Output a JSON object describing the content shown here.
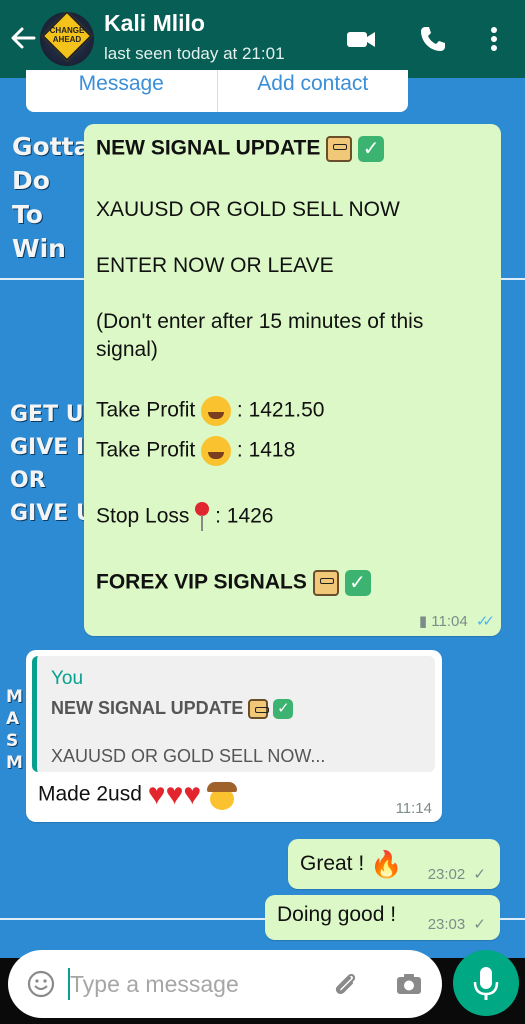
{
  "header": {
    "contact_name": "Kali Mlilo",
    "last_seen": "last seen today at 21:01",
    "avatar_text": "CHANGE AHEAD"
  },
  "action_card": {
    "message_label": "Message",
    "add_contact_label": "Add contact"
  },
  "wallpaper": {
    "line1": [
      "Gotta",
      "Do",
      "To",
      "Win"
    ],
    "line2": [
      "GET UP",
      "GIVE IT",
      "OR",
      "GIVE U"
    ],
    "line3": [
      "M",
      "A",
      "S",
      "M"
    ]
  },
  "messages": [
    {
      "direction": "outgoing",
      "lines": [
        "NEW SIGNAL UPDATE",
        "XAUUSD OR GOLD SELL NOW",
        "ENTER NOW OR LEAVE",
        "(Don't enter after 15 minutes of this",
        "signal)",
        "Take Profit",
        ": 1421.50",
        "Take Profit",
        ": 1418",
        "Stop Loss",
        ": 1426",
        "FOREX VIP SIGNALS"
      ],
      "time": "11:04",
      "status": "read"
    },
    {
      "direction": "incoming",
      "quote": {
        "author": "You",
        "title": "NEW SIGNAL UPDATE",
        "preview": "XAUUSD OR GOLD SELL NOW..."
      },
      "text": "Made 2usd",
      "time": "11:14"
    },
    {
      "direction": "outgoing",
      "text": "Great !",
      "time": "23:02",
      "status": "sent"
    },
    {
      "direction": "outgoing",
      "text": "Doing good !",
      "time": "23:03",
      "status": "sent"
    }
  ],
  "input": {
    "placeholder": "Type a message"
  },
  "icons": {
    "back": "arrow-left-icon",
    "video": "video-camera-icon",
    "call": "phone-icon",
    "menu": "more-vertical-icon",
    "emoji": "emoji-icon",
    "attach": "paperclip-icon",
    "camera": "camera-icon",
    "mic": "microphone-icon"
  },
  "colors": {
    "header": "#075e54",
    "outgoing_bubble": "#dcf8c6",
    "incoming_bubble": "#ffffff",
    "accent": "#00a884",
    "read_ticks": "#4fb6ec"
  }
}
